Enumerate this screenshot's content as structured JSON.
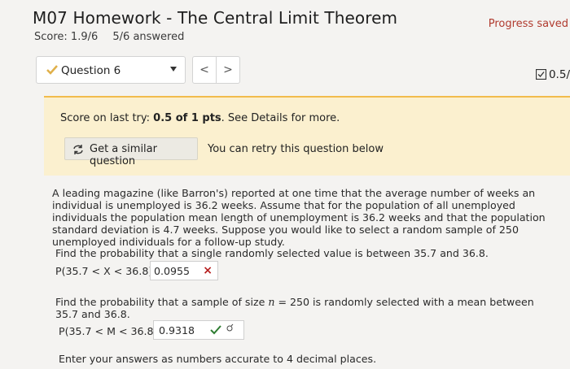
{
  "header": {
    "title": "M07 Homework - The Central Limit Theorem",
    "progress": "Progress saved",
    "score": "Score: 1.9/6",
    "answered": "5/6 answered"
  },
  "question_nav": {
    "label": "Question 6",
    "prev": "<",
    "next": ">",
    "points": "0.5/"
  },
  "feedback": {
    "last_try_prefix": "Score on last try: ",
    "last_try_score": "0.5 of 1 pts",
    "last_try_suffix": ". See Details for more.",
    "similar_button": "Get a similar question",
    "retry_text": "You can retry this question below"
  },
  "problem": {
    "text": "A leading magazine (like Barron's) reported at one time that the average number of weeks an individual is unemployed is 36.2 weeks. Assume that for the population of all unemployed individuals the population mean length of unemployment is 36.2 weeks and that the population standard deviation is 4.7 weeks. Suppose you would like to select a random sample of 250 unemployed individuals for a follow-up study.",
    "q1": "Find the probability that a single randomly selected value is between 35.7 and 36.8.",
    "p1_label": "P(35.7 < X < 36.8) =",
    "p1_answer": "0.0955",
    "p1_mark": "×",
    "q2_prefix": "Find the probability that a sample of size ",
    "q2_var": "n",
    "q2_eq": " = ",
    "q2_suffix": "250 is randomly selected with a mean between 35.7 and 36.8.",
    "p2_label": "P(35.7 < M < 36.8) =",
    "p2_answer": "0.9318",
    "note": "Enter your answers as numbers accurate to 4 decimal places."
  },
  "colors": {
    "panel_bg": "#fbf0cf",
    "panel_border": "#f2bc4c",
    "progress": "#b03a2e",
    "wrong": "#b61e1e",
    "correct": "#2e7d32"
  }
}
